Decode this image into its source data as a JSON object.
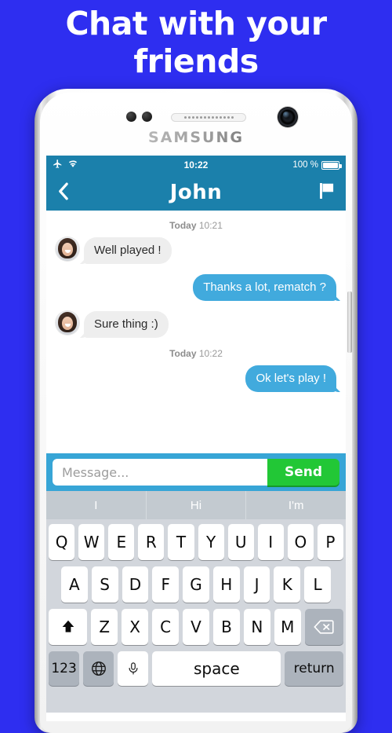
{
  "headline": "Chat with your friends",
  "theme": {
    "background": "#2e2ef0",
    "statusbar": "#1b80ab",
    "navbar": "#1b80ab",
    "inputbar": "#37a5d6",
    "send_green": "#22c736",
    "bubble_blue": "#41aadd",
    "bubble_gray": "#eeeeee",
    "keyboard_bg": "#d2d6dc",
    "suggestbar_bg": "#c3cad0"
  },
  "device": {
    "brand": "SAMSUNG",
    "sensor_icon": "proximity-sensor-icon",
    "speaker_icon": "earpiece-speaker-icon",
    "camera_icon": "front-camera-icon",
    "side_button": "power-button"
  },
  "statusbar": {
    "airplane_icon": "airplane-mode-icon",
    "wifi_icon": "wifi-icon",
    "time": "10:22",
    "battery_percent": "100 %",
    "battery_icon": "battery-full-icon"
  },
  "navbar": {
    "back_icon": "chevron-left-icon",
    "title": "John",
    "flag_icon": "flag-icon"
  },
  "conversation": [
    {
      "type": "daystamp",
      "day": "Today",
      "time": "10:21"
    },
    {
      "type": "message",
      "side": "them",
      "text": "Well played !",
      "avatar": "contact-avatar"
    },
    {
      "type": "message",
      "side": "me",
      "text": "Thanks a lot, rematch ?"
    },
    {
      "type": "message",
      "side": "them",
      "text": "Sure thing :)",
      "avatar": "contact-avatar"
    },
    {
      "type": "daystamp",
      "day": "Today",
      "time": "10:22"
    },
    {
      "type": "message",
      "side": "me",
      "text": "Ok let's play !"
    }
  ],
  "messages": {
    "m0_day": "Today",
    "m0_time": "10:21",
    "m1": "Well played !",
    "m2": "Thanks a lot, rematch ?",
    "m3": "Sure thing :)",
    "m4_day": "Today",
    "m4_time": "10:22",
    "m5": "Ok let's play !"
  },
  "input": {
    "placeholder": "Message...",
    "value": "",
    "send_label": "Send"
  },
  "keyboard": {
    "suggestions": [
      "I",
      "Hi",
      "I'm"
    ],
    "row1": [
      "Q",
      "W",
      "E",
      "R",
      "T",
      "Y",
      "U",
      "I",
      "O",
      "P"
    ],
    "row2": [
      "A",
      "S",
      "D",
      "F",
      "G",
      "H",
      "J",
      "K",
      "L"
    ],
    "row3": [
      "Z",
      "X",
      "C",
      "V",
      "B",
      "N",
      "M"
    ],
    "shift_icon": "shift-arrow-icon",
    "backspace_icon": "backspace-delete-icon",
    "numbers_label": "123",
    "globe_icon": "globe-language-icon",
    "mic_icon": "microphone-icon",
    "space_label": "space",
    "return_label": "return"
  }
}
